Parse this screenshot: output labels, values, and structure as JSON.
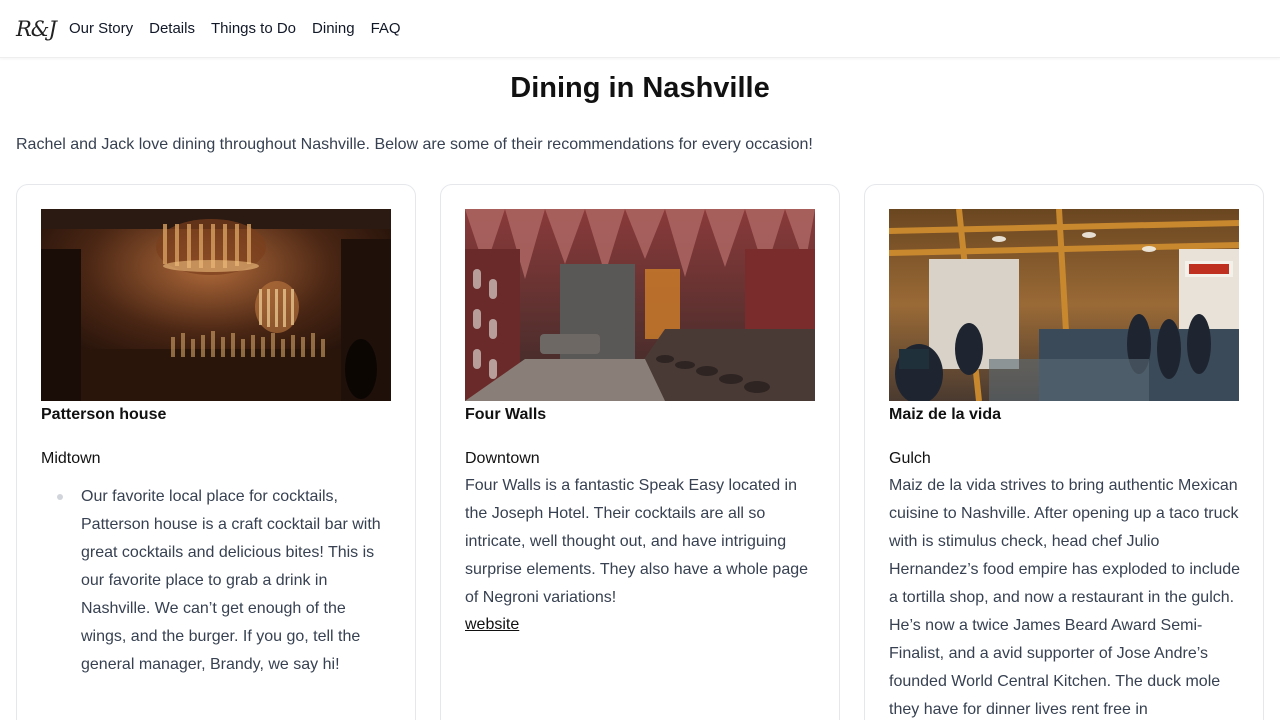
{
  "nav": {
    "logo": "R&J",
    "links": [
      "Our Story",
      "Details",
      "Things to Do",
      "Dining",
      "FAQ"
    ]
  },
  "page": {
    "title": "Dining in Nashville",
    "intro": "Rachel and Jack love dining throughout Nashville. Below are some of their recommendations for every occasion!"
  },
  "cards": [
    {
      "name": "Patterson house",
      "area": "Midtown",
      "description": "Our favorite local place for cocktails, Patterson house is a craft cocktail bar with great cocktails and delicious bites! This is our favorite place to grab a drink in Nashville. We can’t get enough of the wings, and the burger. If you go, tell the general manager, Brandy, we say hi!"
    },
    {
      "name": "Four Walls",
      "area": "Downtown",
      "description": "Four Walls is a fantastic Speak Easy located in the Joseph Hotel. Their cocktails are all so intricate, well thought out, and have intriguing surprise elements. They also have a whole page of Negroni variations!",
      "link": "website"
    },
    {
      "name": "Maiz de la vida",
      "area": "Gulch",
      "description": "Maiz de la vida strives to bring authentic Mexican cuisine to Nashville. After opening up a taco truck with is stimulus check, head chef Julio Hernandez’s food empire has exploded to include a tortilla shop, and now a restaurant in the gulch. He’s now a twice James Beard Award Semi-Finalist, and a avid supporter of Jose Andre’s founded World Central Kitchen. The duck mole they have for dinner lives rent free in"
    }
  ]
}
